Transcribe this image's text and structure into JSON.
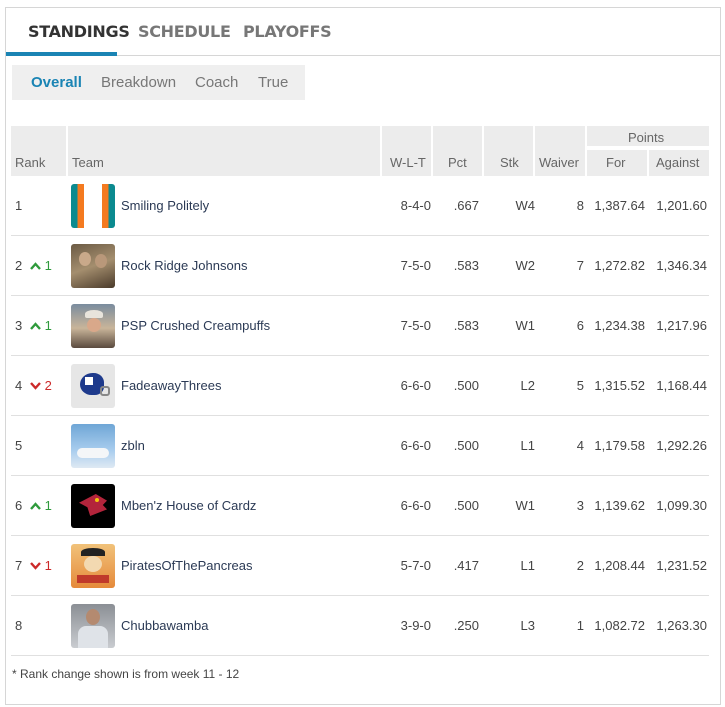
{
  "tabs": [
    {
      "label": "STANDINGS",
      "active": true
    },
    {
      "label": "SCHEDULE",
      "active": false
    },
    {
      "label": "PLAYOFFS",
      "active": false
    }
  ],
  "subnav": [
    {
      "label": "Overall",
      "active": true
    },
    {
      "label": "Breakdown",
      "active": false
    },
    {
      "label": "Coach",
      "active": false
    },
    {
      "label": "True",
      "active": false
    }
  ],
  "table": {
    "group_header": "Points",
    "headers": {
      "rank": "Rank",
      "team": "Team",
      "wlt": "W-L-T",
      "pct": "Pct",
      "stk": "Stk",
      "waiver": "Waiver",
      "for": "For",
      "against": "Against"
    },
    "rows": [
      {
        "rank": "1",
        "change": "",
        "change_dir": "none",
        "team": "Smiling Politely",
        "logo": "dolphins-stripes-logo",
        "wlt": "8-4-0",
        "pct": ".667",
        "stk": "W4",
        "waiver": "8",
        "pf": "1,387.64",
        "pa": "1,201.60"
      },
      {
        "rank": "2",
        "change": "1",
        "change_dir": "up",
        "team": "Rock Ridge Johnsons",
        "logo": "two-men-photo",
        "wlt": "7-5-0",
        "pct": ".583",
        "stk": "W2",
        "waiver": "7",
        "pf": "1,272.82",
        "pa": "1,346.34"
      },
      {
        "rank": "3",
        "change": "1",
        "change_dir": "up",
        "team": "PSP Crushed Creampuffs",
        "logo": "man-in-hat-photo",
        "wlt": "7-5-0",
        "pct": ".583",
        "stk": "W1",
        "waiver": "6",
        "pf": "1,234.38",
        "pa": "1,217.96"
      },
      {
        "rank": "4",
        "change": "2",
        "change_dir": "down",
        "team": "FadeawayThrees",
        "logo": "football-helmet-logo",
        "wlt": "6-6-0",
        "pct": ".500",
        "stk": "L2",
        "waiver": "5",
        "pf": "1,315.52",
        "pa": "1,168.44"
      },
      {
        "rank": "5",
        "change": "",
        "change_dir": "none",
        "team": "zbln",
        "logo": "sky-clouds-photo",
        "wlt": "6-6-0",
        "pct": ".500",
        "stk": "L1",
        "waiver": "4",
        "pf": "1,179.58",
        "pa": "1,292.26"
      },
      {
        "rank": "6",
        "change": "1",
        "change_dir": "up",
        "team": "Mben'z House of Cardz",
        "logo": "cardinal-bird-logo",
        "wlt": "6-6-0",
        "pct": ".500",
        "stk": "W1",
        "waiver": "3",
        "pf": "1,139.62",
        "pa": "1,099.30"
      },
      {
        "rank": "7",
        "change": "1",
        "change_dir": "down",
        "team": "PiratesOfThePancreas",
        "logo": "pirate-cartoon-logo",
        "wlt": "5-7-0",
        "pct": ".417",
        "stk": "L1",
        "waiver": "2",
        "pf": "1,208.44",
        "pa": "1,231.52"
      },
      {
        "rank": "8",
        "change": "",
        "change_dir": "none",
        "team": "Chubbawamba",
        "logo": "man-in-shirt-photo",
        "wlt": "3-9-0",
        "pct": ".250",
        "stk": "L3",
        "waiver": "1",
        "pf": "1,082.72",
        "pa": "1,263.30"
      }
    ]
  },
  "footnote": "* Rank change shown is from week 11 - 12",
  "colors": {
    "accent": "#1a84b4",
    "up": "#2f9a3c",
    "down": "#cc2a2a",
    "team_link": "#2b3a55"
  }
}
